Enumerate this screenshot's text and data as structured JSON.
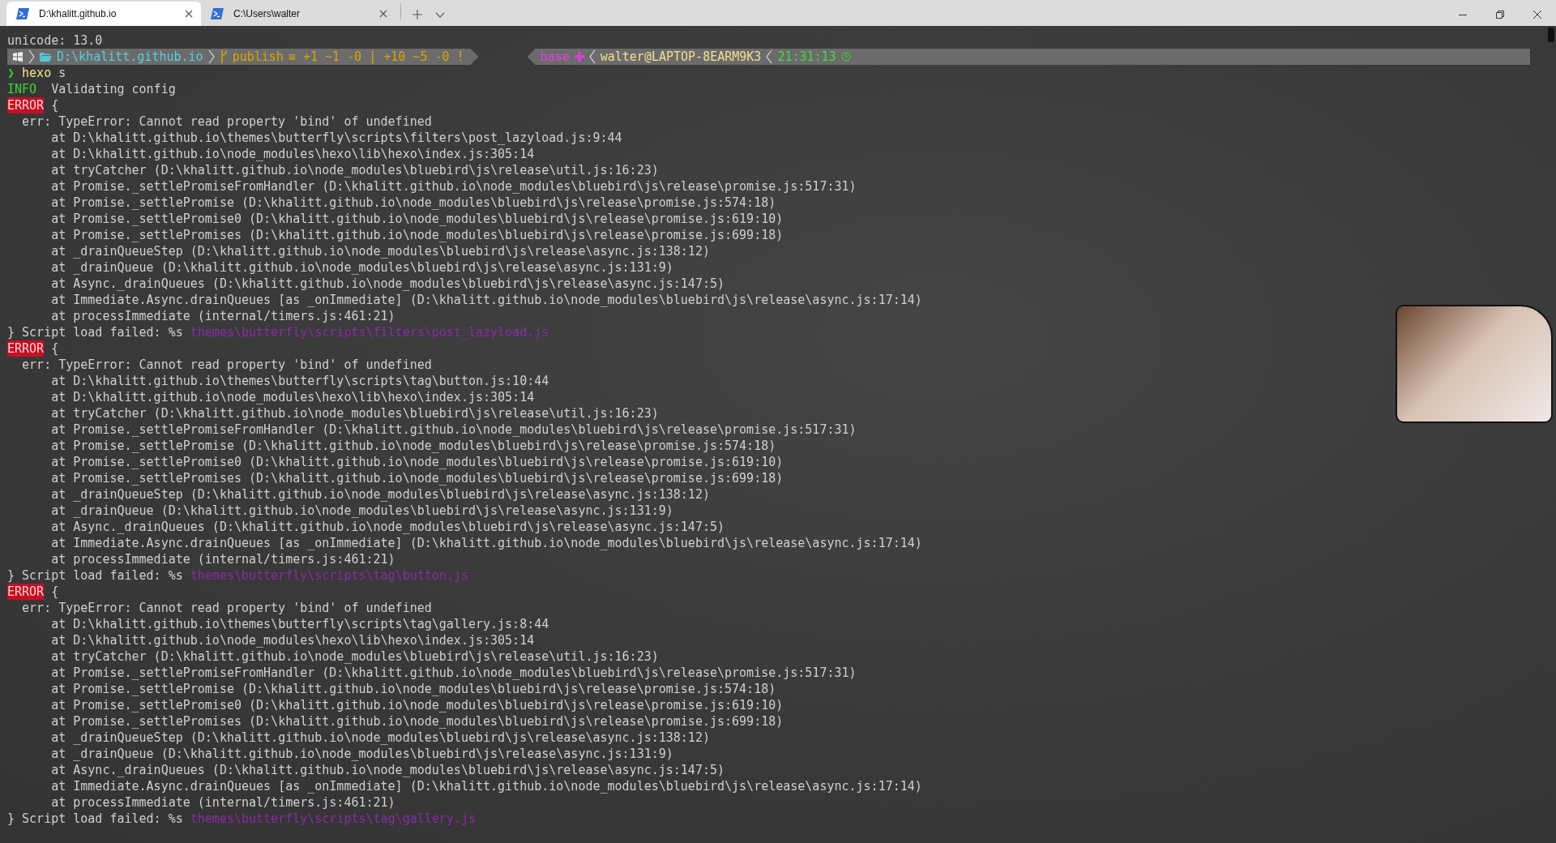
{
  "tabs": [
    {
      "title": "D:\\khalitt.github.io",
      "selected": true
    },
    {
      "title": "C:\\Users\\walter",
      "selected": false
    }
  ],
  "prompt": {
    "path": "D:\\khalitt.github.io",
    "branch": "publish",
    "git_status": "≡ +1 ~1 -0 | +10 ~5 -0 !",
    "env": "base",
    "host": "walter@LAPTOP-8EARM9K3",
    "time": "21:31:13"
  },
  "log": [
    {
      "kind": "text",
      "text": "unicode: 13.0"
    },
    {
      "kind": "prompt"
    },
    {
      "kind": "command",
      "symbol": "❯",
      "command": "hexo",
      "args": "s"
    },
    {
      "kind": "info",
      "tag": "INFO",
      "text": "Validating config"
    },
    {
      "kind": "error",
      "tag": "ERROR",
      "text": "{"
    },
    {
      "kind": "err",
      "text": "err: TypeError: Cannot read property 'bind' of undefined"
    },
    {
      "kind": "stack",
      "text": "at D:\\khalitt.github.io\\themes\\butterfly\\scripts\\filters\\post_lazyload.js:9:44"
    },
    {
      "kind": "stack",
      "text": "at D:\\khalitt.github.io\\node_modules\\hexo\\lib\\hexo\\index.js:305:14"
    },
    {
      "kind": "stack",
      "text": "at tryCatcher (D:\\khalitt.github.io\\node_modules\\bluebird\\js\\release\\util.js:16:23)"
    },
    {
      "kind": "stack",
      "text": "at Promise._settlePromiseFromHandler (D:\\khalitt.github.io\\node_modules\\bluebird\\js\\release\\promise.js:517:31)"
    },
    {
      "kind": "stack",
      "text": "at Promise._settlePromise (D:\\khalitt.github.io\\node_modules\\bluebird\\js\\release\\promise.js:574:18)"
    },
    {
      "kind": "stack",
      "text": "at Promise._settlePromise0 (D:\\khalitt.github.io\\node_modules\\bluebird\\js\\release\\promise.js:619:10)"
    },
    {
      "kind": "stack",
      "text": "at Promise._settlePromises (D:\\khalitt.github.io\\node_modules\\bluebird\\js\\release\\promise.js:699:18)"
    },
    {
      "kind": "stack",
      "text": "at _drainQueueStep (D:\\khalitt.github.io\\node_modules\\bluebird\\js\\release\\async.js:138:12)"
    },
    {
      "kind": "stack",
      "text": "at _drainQueue (D:\\khalitt.github.io\\node_modules\\bluebird\\js\\release\\async.js:131:9)"
    },
    {
      "kind": "stack",
      "text": "at Async._drainQueues (D:\\khalitt.github.io\\node_modules\\bluebird\\js\\release\\async.js:147:5)"
    },
    {
      "kind": "stack",
      "text": "at Immediate.Async.drainQueues [as _onImmediate] (D:\\khalitt.github.io\\node_modules\\bluebird\\js\\release\\async.js:17:14)"
    },
    {
      "kind": "stack",
      "text": "at processImmediate (internal/timers.js:461:21)"
    },
    {
      "kind": "failed",
      "text": "} Script load failed: %s",
      "path": "themes\\butterfly\\scripts\\filters\\post_lazyload.js"
    },
    {
      "kind": "error",
      "tag": "ERROR",
      "text": "{"
    },
    {
      "kind": "err",
      "text": "err: TypeError: Cannot read property 'bind' of undefined"
    },
    {
      "kind": "stack",
      "text": "at D:\\khalitt.github.io\\themes\\butterfly\\scripts\\tag\\button.js:10:44"
    },
    {
      "kind": "stack",
      "text": "at D:\\khalitt.github.io\\node_modules\\hexo\\lib\\hexo\\index.js:305:14"
    },
    {
      "kind": "stack",
      "text": "at tryCatcher (D:\\khalitt.github.io\\node_modules\\bluebird\\js\\release\\util.js:16:23)"
    },
    {
      "kind": "stack",
      "text": "at Promise._settlePromiseFromHandler (D:\\khalitt.github.io\\node_modules\\bluebird\\js\\release\\promise.js:517:31)"
    },
    {
      "kind": "stack",
      "text": "at Promise._settlePromise (D:\\khalitt.github.io\\node_modules\\bluebird\\js\\release\\promise.js:574:18)"
    },
    {
      "kind": "stack",
      "text": "at Promise._settlePromise0 (D:\\khalitt.github.io\\node_modules\\bluebird\\js\\release\\promise.js:619:10)"
    },
    {
      "kind": "stack",
      "text": "at Promise._settlePromises (D:\\khalitt.github.io\\node_modules\\bluebird\\js\\release\\promise.js:699:18)"
    },
    {
      "kind": "stack",
      "text": "at _drainQueueStep (D:\\khalitt.github.io\\node_modules\\bluebird\\js\\release\\async.js:138:12)"
    },
    {
      "kind": "stack",
      "text": "at _drainQueue (D:\\khalitt.github.io\\node_modules\\bluebird\\js\\release\\async.js:131:9)"
    },
    {
      "kind": "stack",
      "text": "at Async._drainQueues (D:\\khalitt.github.io\\node_modules\\bluebird\\js\\release\\async.js:147:5)"
    },
    {
      "kind": "stack",
      "text": "at Immediate.Async.drainQueues [as _onImmediate] (D:\\khalitt.github.io\\node_modules\\bluebird\\js\\release\\async.js:17:14)"
    },
    {
      "kind": "stack",
      "text": "at processImmediate (internal/timers.js:461:21)"
    },
    {
      "kind": "failed",
      "text": "} Script load failed: %s",
      "path": "themes\\butterfly\\scripts\\tag\\button.js"
    },
    {
      "kind": "error",
      "tag": "ERROR",
      "text": "{"
    },
    {
      "kind": "err",
      "text": "err: TypeError: Cannot read property 'bind' of undefined"
    },
    {
      "kind": "stack",
      "text": "at D:\\khalitt.github.io\\themes\\butterfly\\scripts\\tag\\gallery.js:8:44"
    },
    {
      "kind": "stack",
      "text": "at D:\\khalitt.github.io\\node_modules\\hexo\\lib\\hexo\\index.js:305:14"
    },
    {
      "kind": "stack",
      "text": "at tryCatcher (D:\\khalitt.github.io\\node_modules\\bluebird\\js\\release\\util.js:16:23)"
    },
    {
      "kind": "stack",
      "text": "at Promise._settlePromiseFromHandler (D:\\khalitt.github.io\\node_modules\\bluebird\\js\\release\\promise.js:517:31)"
    },
    {
      "kind": "stack",
      "text": "at Promise._settlePromise (D:\\khalitt.github.io\\node_modules\\bluebird\\js\\release\\promise.js:574:18)"
    },
    {
      "kind": "stack",
      "text": "at Promise._settlePromise0 (D:\\khalitt.github.io\\node_modules\\bluebird\\js\\release\\promise.js:619:10)"
    },
    {
      "kind": "stack",
      "text": "at Promise._settlePromises (D:\\khalitt.github.io\\node_modules\\bluebird\\js\\release\\promise.js:699:18)"
    },
    {
      "kind": "stack",
      "text": "at _drainQueueStep (D:\\khalitt.github.io\\node_modules\\bluebird\\js\\release\\async.js:138:12)"
    },
    {
      "kind": "stack",
      "text": "at _drainQueue (D:\\khalitt.github.io\\node_modules\\bluebird\\js\\release\\async.js:131:9)"
    },
    {
      "kind": "stack",
      "text": "at Async._drainQueues (D:\\khalitt.github.io\\node_modules\\bluebird\\js\\release\\async.js:147:5)"
    },
    {
      "kind": "stack",
      "text": "at Immediate.Async.drainQueues [as _onImmediate] (D:\\khalitt.github.io\\node_modules\\bluebird\\js\\release\\async.js:17:14)"
    },
    {
      "kind": "stack",
      "text": "at processImmediate (internal/timers.js:461:21)"
    },
    {
      "kind": "failed",
      "text": "} Script load failed: %s",
      "path": "themes\\butterfly\\scripts\\tag\\gallery.js"
    }
  ]
}
